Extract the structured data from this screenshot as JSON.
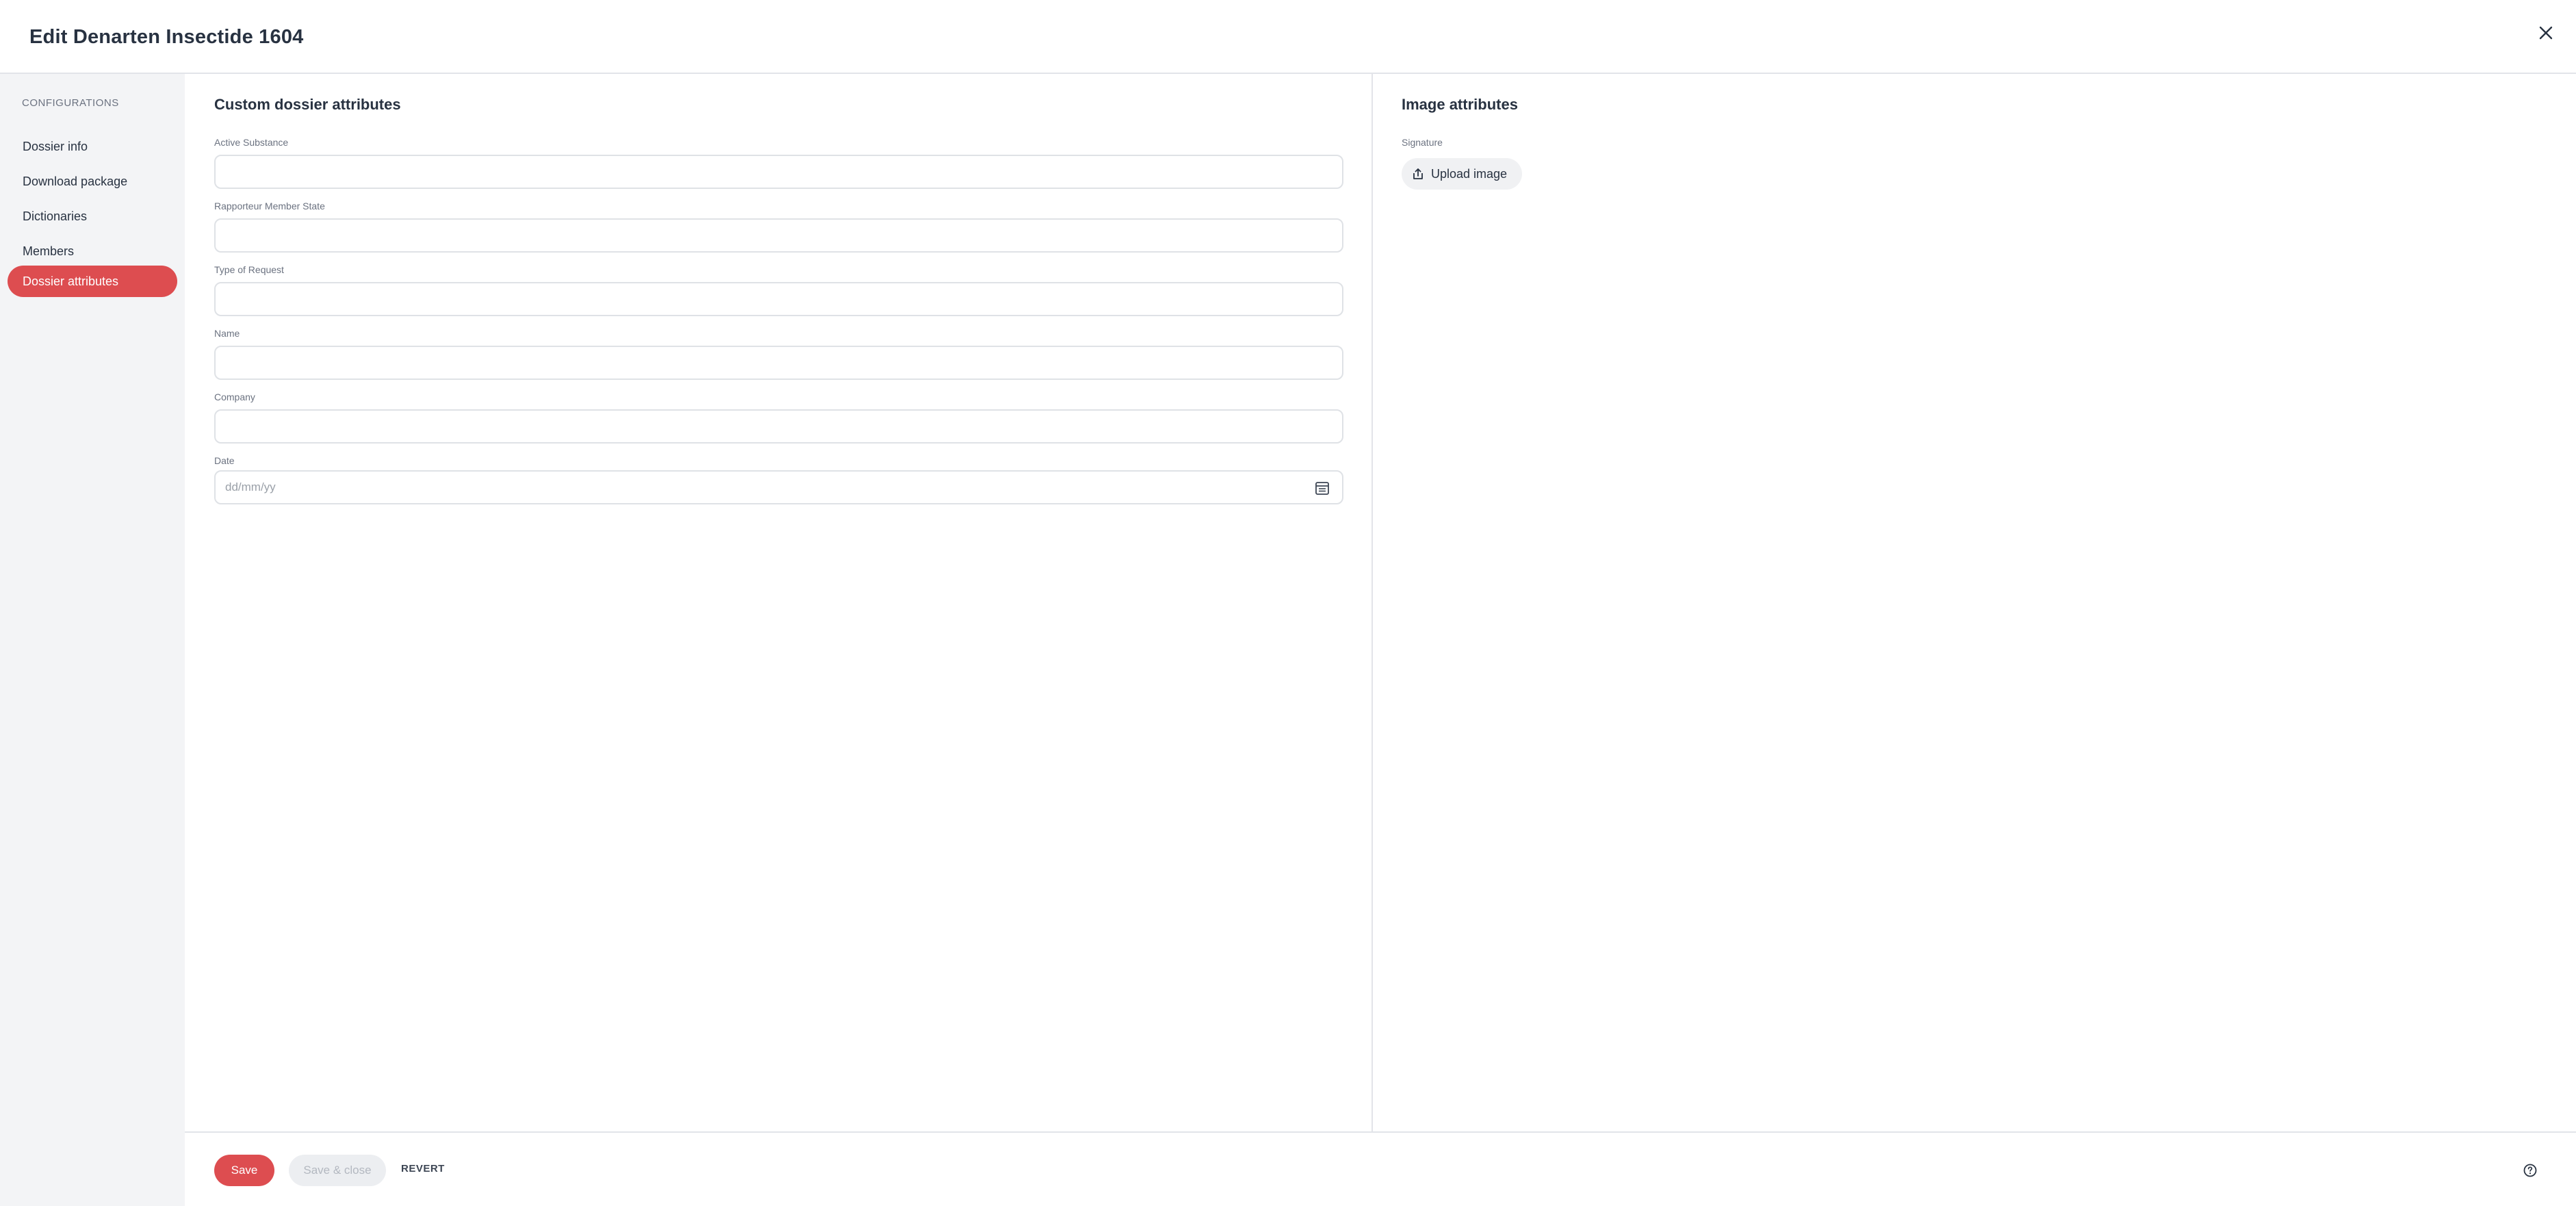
{
  "header": {
    "title": "Edit Denarten Insectide 1604"
  },
  "sidebar": {
    "heading": "CONFIGURATIONS",
    "items": [
      {
        "label": "Dossier info",
        "active": false
      },
      {
        "label": "Download package",
        "active": false
      },
      {
        "label": "Dictionaries",
        "active": false
      },
      {
        "label": "Members",
        "active": false
      },
      {
        "label": "Dossier attributes",
        "active": true
      }
    ]
  },
  "custom_attributes": {
    "title": "Custom dossier attributes",
    "fields": [
      {
        "label": "Active Substance",
        "value": ""
      },
      {
        "label": "Rapporteur Member State",
        "value": ""
      },
      {
        "label": "Type of Request",
        "value": ""
      },
      {
        "label": "Name",
        "value": ""
      },
      {
        "label": "Company",
        "value": ""
      }
    ],
    "date": {
      "label": "Date",
      "placeholder": "dd/mm/yy",
      "value": ""
    }
  },
  "image_attributes": {
    "title": "Image attributes",
    "signature_label": "Signature",
    "upload_label": "Upload image"
  },
  "footer": {
    "save_label": "Save",
    "save_close_label": "Save & close",
    "revert_label": "REVERT"
  },
  "colors": {
    "accent": "#dd4d50",
    "sidebar_bg": "#f3f4f6",
    "text": "#283241",
    "muted": "#6b7280"
  }
}
